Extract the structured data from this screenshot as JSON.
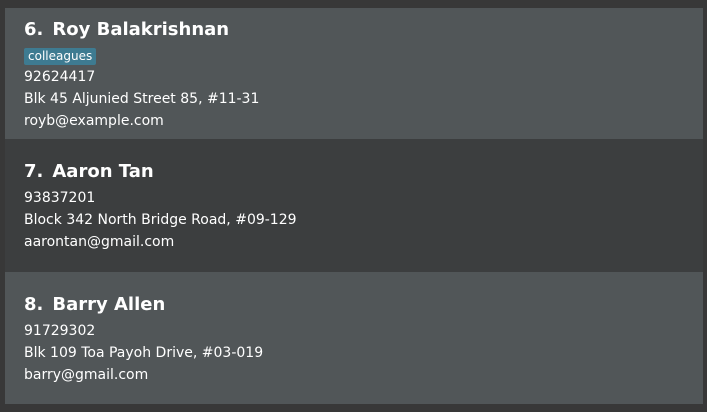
{
  "persons": [
    {
      "index": "6.",
      "name": "Roy Balakrishnan",
      "tags": [
        "colleagues"
      ],
      "phone": "92624417",
      "address": "Blk 45 Aljunied Street 85, #11-31",
      "email": "royb@example.com"
    },
    {
      "index": "7.",
      "name": "Aaron Tan",
      "tags": [],
      "phone": "93837201",
      "address": "Block 342 North Bridge Road, #09-129",
      "email": "aarontan@gmail.com"
    },
    {
      "index": "8.",
      "name": "Barry Allen",
      "tags": [],
      "phone": "91729302",
      "address": "Blk 109 Toa Payoh Drive, #03-019",
      "email": "barry@gmail.com"
    }
  ],
  "colors": {
    "card_light": "#515658",
    "card_dark": "#3c3e3f",
    "tag_background": "#3e7b91",
    "text": "#ffffff",
    "background": "#383838"
  }
}
